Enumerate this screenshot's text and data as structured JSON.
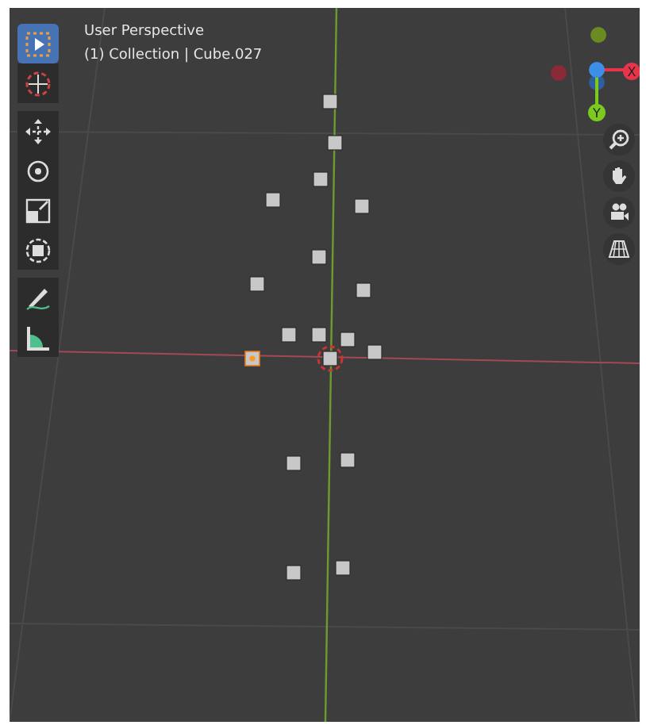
{
  "viewport": {
    "view_name": "User Perspective",
    "object_info": "(1) Collection | Cube.027"
  },
  "toolbar": {
    "groups": [
      [
        {
          "kind": "select",
          "selected": true
        },
        {
          "kind": "cursor",
          "selected": false
        }
      ],
      [
        {
          "kind": "move",
          "selected": false
        },
        {
          "kind": "rotate",
          "selected": false
        },
        {
          "kind": "scale",
          "selected": false
        },
        {
          "kind": "transform",
          "selected": false
        }
      ],
      [
        {
          "kind": "annotate",
          "selected": false
        },
        {
          "kind": "measure",
          "selected": false
        }
      ]
    ]
  },
  "gizmo": {
    "x_label": "X",
    "y_label": "Y"
  },
  "navigation": [
    {
      "kind": "zoom"
    },
    {
      "kind": "pan"
    },
    {
      "kind": "camera"
    },
    {
      "kind": "ortho"
    }
  ]
}
